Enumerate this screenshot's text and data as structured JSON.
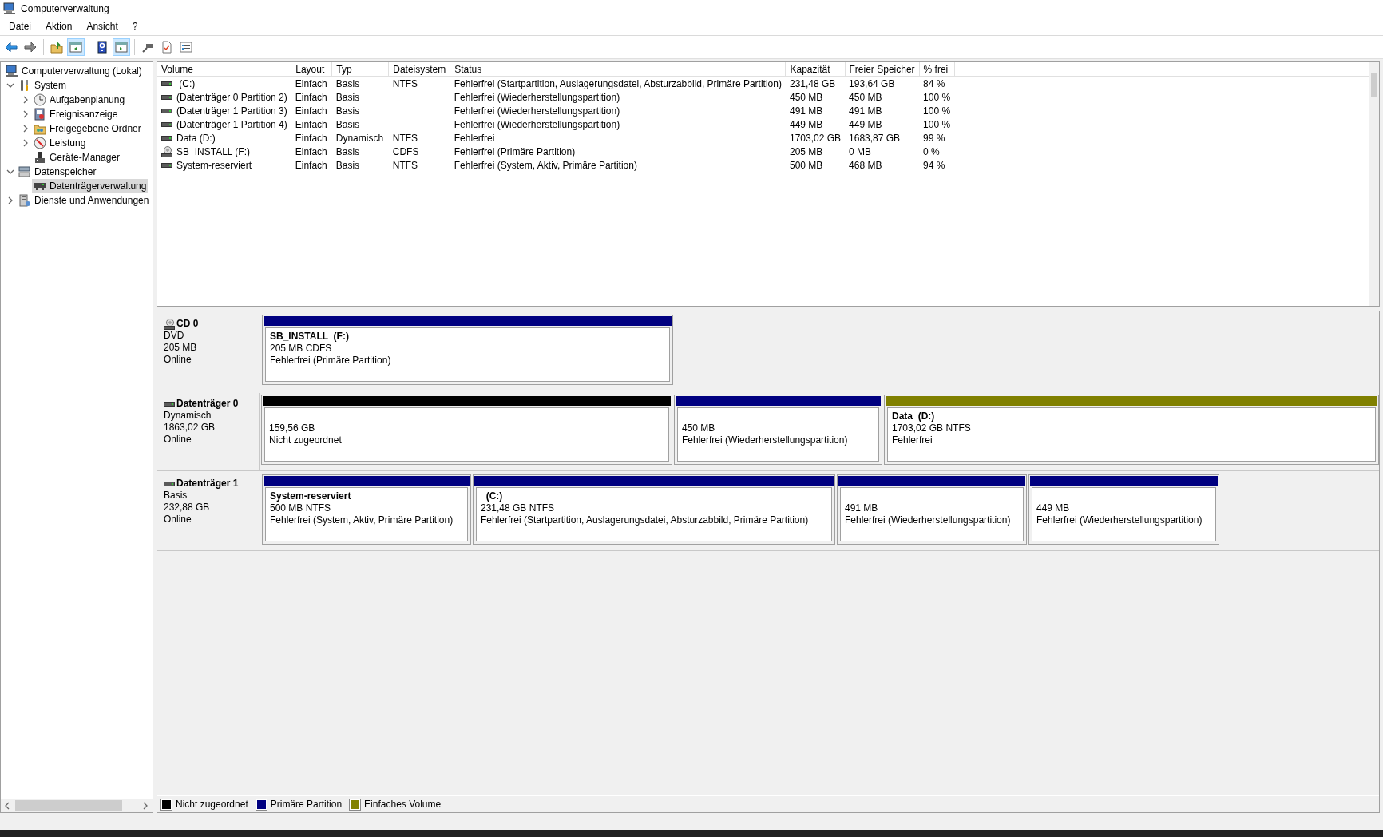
{
  "window": {
    "title": "Computerverwaltung"
  },
  "menu": [
    "Datei",
    "Aktion",
    "Ansicht",
    "?"
  ],
  "toolbar": [
    {
      "pressed": false
    },
    {
      "pressed": false
    },
    {
      "pressed": false
    },
    {
      "pressed": true
    },
    {
      "pressed": false
    },
    {
      "pressed": true
    },
    {
      "pressed": false
    },
    {
      "pressed": false
    },
    {
      "pressed": false
    }
  ],
  "tree": [
    {
      "label": "Computerverwaltung (Lokal)",
      "selected": false,
      "children": [
        {
          "label": "System",
          "expanded": true,
          "selected": false,
          "children": [
            {
              "label": "Aufgabenplanung",
              "expanded": false,
              "selected": false
            },
            {
              "label": "Ereignisanzeige",
              "expanded": false,
              "selected": false
            },
            {
              "label": "Freigegebene Ordner",
              "expanded": false,
              "selected": false
            },
            {
              "label": "Leistung",
              "expanded": false,
              "selected": false
            },
            {
              "label": "Geräte-Manager",
              "selected": false
            }
          ]
        },
        {
          "label": "Datenspeicher",
          "expanded": true,
          "selected": false,
          "children": [
            {
              "label": "Datenträgerverwaltung",
              "selected": true
            }
          ]
        },
        {
          "label": "Dienste und Anwendungen",
          "expanded": false,
          "selected": false
        }
      ]
    }
  ],
  "table": {
    "columns": [
      "Volume",
      "Layout",
      "Typ",
      "Dateisystem",
      "Status",
      "Kapazität",
      "Freier Speicher",
      "% frei"
    ],
    "rows": [
      {
        "kind": "disk",
        "volume": " (C:)",
        "layout": "Einfach",
        "type": "Basis",
        "filesystem": "NTFS",
        "status": "Fehlerfrei (Startpartition, Auslagerungsdatei, Absturzabbild, Primäre Partition)",
        "capacity": "231,48 GB",
        "free": "193,64 GB",
        "percent": "84 %"
      },
      {
        "kind": "disk",
        "volume": "(Datenträger 0 Partition 2)",
        "layout": "Einfach",
        "type": "Basis",
        "status": "Fehlerfrei (Wiederherstellungspartition)",
        "capacity": "450 MB",
        "free": "450 MB",
        "percent": "100 %"
      },
      {
        "kind": "disk",
        "volume": "(Datenträger 1 Partition 3)",
        "layout": "Einfach",
        "type": "Basis",
        "status": "Fehlerfrei (Wiederherstellungspartition)",
        "capacity": "491 MB",
        "free": "491 MB",
        "percent": "100 %"
      },
      {
        "kind": "disk",
        "volume": "(Datenträger 1 Partition 4)",
        "layout": "Einfach",
        "type": "Basis",
        "status": "Fehlerfrei (Wiederherstellungspartition)",
        "capacity": "449 MB",
        "free": "449 MB",
        "percent": "100 %"
      },
      {
        "kind": "disk",
        "volume": "Data (D:)",
        "layout": "Einfach",
        "type": "Dynamisch",
        "filesystem": "NTFS",
        "status": "Fehlerfrei",
        "capacity": "1703,02 GB",
        "free": "1683,87 GB",
        "percent": "99 %"
      },
      {
        "kind": "optical",
        "volume": "SB_INSTALL (F:)",
        "layout": "Einfach",
        "type": "Basis",
        "filesystem": "CDFS",
        "status": "Fehlerfrei (Primäre Partition)",
        "capacity": "205 MB",
        "free": "0 MB",
        "percent": "0 %"
      },
      {
        "kind": "disk",
        "volume": "System-reserviert",
        "layout": "Einfach",
        "type": "Basis",
        "filesystem": "NTFS",
        "status": "Fehlerfrei (System, Aktiv, Primäre Partition)",
        "capacity": "500 MB",
        "free": "468 MB",
        "percent": "94 %"
      }
    ]
  },
  "disks": [
    {
      "kind": "optical",
      "name": "CD 0",
      "type": "DVD",
      "size": "205 MB",
      "state": "Online",
      "partitions": [
        {
          "kind": "primary",
          "name": "SB_INSTALL  (F:)",
          "size": "205 MB CDFS",
          "status": "Fehlerfrei (Primäre Partition)"
        }
      ]
    },
    {
      "kind": "disk",
      "name": "Datenträger 0",
      "type": "Dynamisch",
      "size": "1863,02 GB",
      "state": "Online",
      "partitions": [
        {
          "kind": "unallocated",
          "size": "159,56 GB",
          "status": "Nicht zugeordnet"
        },
        {
          "kind": "primary",
          "size": "450 MB",
          "status": "Fehlerfrei (Wiederherstellungspartition)"
        },
        {
          "kind": "simple",
          "name": "Data  (D:)",
          "size": "1703,02 GB NTFS",
          "status": "Fehlerfrei"
        }
      ]
    },
    {
      "kind": "disk",
      "name": "Datenträger 1",
      "type": "Basis",
      "size": "232,88 GB",
      "state": "Online",
      "partitions": [
        {
          "kind": "primary",
          "name": "System-reserviert",
          "size": "500 MB NTFS",
          "status": "Fehlerfrei (System, Aktiv, Primäre Partition)"
        },
        {
          "kind": "primary",
          "name": "  (C:)",
          "size": "231,48 GB NTFS",
          "status": "Fehlerfrei (Startpartition, Auslagerungsdatei, Absturzabbild, Primäre Partition)"
        },
        {
          "kind": "primary",
          "size": "491 MB",
          "status": "Fehlerfrei (Wiederherstellungspartition)"
        },
        {
          "kind": "primary",
          "size": "449 MB",
          "status": "Fehlerfrei (Wiederherstellungspartition)"
        }
      ]
    }
  ],
  "legend": [
    {
      "label": "Nicht zugeordnet",
      "color": "#000000"
    },
    {
      "label": "Primäre Partition",
      "color": "#000080"
    },
    {
      "label": "Einfaches Volume",
      "color": "#808000"
    }
  ]
}
